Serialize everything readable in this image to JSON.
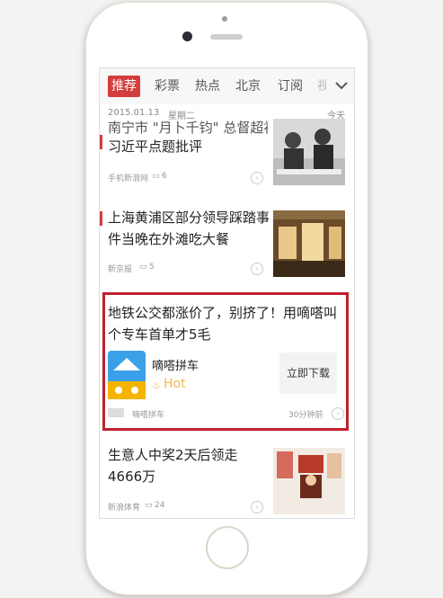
{
  "tabs": [
    "推荐",
    "彩票",
    "热点",
    "北京",
    "订阅",
    "视"
  ],
  "date": "2015.01.13",
  "weekday": "星期二",
  "today": "今天",
  "news": [
    {
      "title_line1": "习近平点题批评",
      "title_partial": "南宁市 \"月卜千钧\" 总督超初",
      "source": "手机新浪网",
      "comments": "6"
    },
    {
      "title": "上海黄浦区部分领导踩踏事件当晚在外滩吃大餐",
      "source": "新京报",
      "comments": "5"
    },
    {
      "title": "生意人中奖2天后领走4666万",
      "source": "新浪体育",
      "comments": "24"
    }
  ],
  "ad": {
    "title": "地铁公交都涨价了，别挤了！用嘀嗒叫个专车首单才5毛",
    "app_name": "嘀嗒拼车",
    "hot": "Hot",
    "download": "立即下载",
    "source": "嘀嗒拼车",
    "time": "30分钟前"
  }
}
